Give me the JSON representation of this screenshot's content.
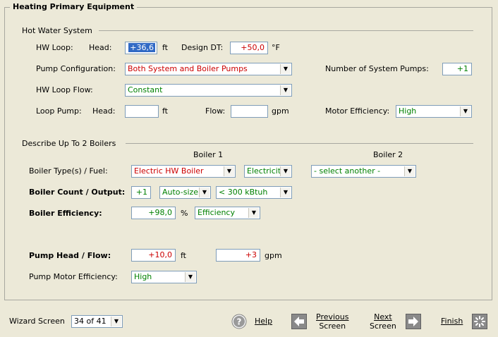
{
  "frame_title": "Heating Primary Equipment",
  "hw_section": {
    "title": "Hot Water System",
    "hw_loop_label": "HW Loop:",
    "head_label": "Head:",
    "head_value": "+36,6",
    "head_unit": "ft",
    "design_dt_label": "Design DT:",
    "design_dt_value": "+50,0",
    "design_dt_unit": "°F",
    "pump_config_label": "Pump Configuration:",
    "pump_config_value": "Both System and Boiler Pumps",
    "num_pumps_label": "Number of System Pumps:",
    "num_pumps_value": "+1",
    "loop_flow_label": "HW Loop Flow:",
    "loop_flow_value": "Constant",
    "loop_pump_label": "Loop Pump:",
    "loop_pump_head_label": "Head:",
    "loop_pump_head_unit": "ft",
    "flow_label": "Flow:",
    "flow_unit": "gpm",
    "motor_eff_label": "Motor Efficiency:",
    "motor_eff_value": "High"
  },
  "boiler_section": {
    "title": "Describe Up To 2 Boilers",
    "boiler1_header": "Boiler 1",
    "boiler2_header": "Boiler 2",
    "type_label": "Boiler Type(s) / Fuel:",
    "type_value": "Electric HW Boiler",
    "fuel_value": "Electricit",
    "boiler2_value": "- select another -",
    "count_label": "Boiler Count / Output:",
    "count_value": "+1",
    "autosize_value": "Auto-size",
    "output_value": "< 300 kBtuh",
    "eff_label": "Boiler Efficiency:",
    "eff_value": "+98,0",
    "eff_unit": "%",
    "eff_type_value": "Efficiency",
    "pump_head_label": "Pump Head / Flow:",
    "pump_head_value": "+10,0",
    "pump_head_unit": "ft",
    "pump_flow_value": "+3",
    "pump_flow_unit": "gpm",
    "pump_motor_label": "Pump Motor Efficiency:",
    "pump_motor_value": "High"
  },
  "footer": {
    "wizard_label": "Wizard Screen",
    "wizard_value": "34 of 41",
    "help_label": "Help",
    "prev_line1": "Previous",
    "prev_line2": "Screen",
    "next_line1": "Next",
    "next_line2": "Screen",
    "finish_label": "Finish"
  },
  "colors": {
    "background": "#ece9d8",
    "input_border": "#7f9db9",
    "highlight": "#316ac5",
    "user_value": "#cc0000",
    "default_value": "#008000"
  },
  "icons": [
    "help-icon",
    "previous-arrow-icon",
    "next-arrow-icon",
    "finish-icon"
  ]
}
